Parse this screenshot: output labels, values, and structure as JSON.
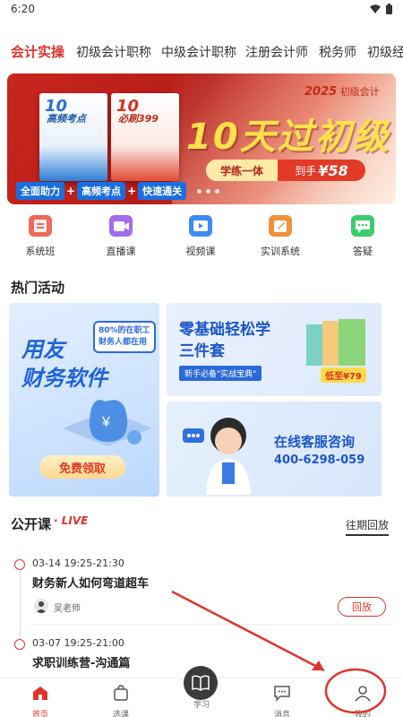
{
  "status": {
    "time": "6:20",
    "wifi_icon": "wifi-icon",
    "battery_icon": "battery-icon"
  },
  "tabs": [
    {
      "label": "会计实操",
      "active": true
    },
    {
      "label": "初级会计职称"
    },
    {
      "label": "中级会计职称"
    },
    {
      "label": "注册会计师"
    },
    {
      "label": "税务师"
    },
    {
      "label": "初级经"
    }
  ],
  "banner": {
    "year_label": "2025",
    "year_suffix": "初级会计",
    "headline": "10天过初级",
    "book1_num": "10",
    "book1_title": "高频考点",
    "book2_num": "10",
    "book2_title": "必刷399",
    "pill_left": "学练一体",
    "pill_prefix": "到手",
    "pill_price": "¥58",
    "tags": [
      "全面助力",
      "高频考点",
      "快速通关"
    ],
    "accent": "#e0342c"
  },
  "nav": [
    {
      "label": "系统班",
      "icon": "class-icon",
      "color": "#ef6a5a"
    },
    {
      "label": "直播课",
      "icon": "live-video-icon",
      "color": "#a36af2"
    },
    {
      "label": "视频课",
      "icon": "video-tv-icon",
      "color": "#3e8cf2"
    },
    {
      "label": "实训系统",
      "icon": "training-edit-icon",
      "color": "#f2903a"
    },
    {
      "label": "答疑",
      "icon": "qa-chat-icon",
      "color": "#3ccd6c"
    }
  ],
  "hot": {
    "title": "热门活动",
    "yongyou_title_1": "用友",
    "yongyou_title_2": "财务软件",
    "yongyou_bubble": "80%的在职工财务人都在用",
    "yongyou_button": "免费领取",
    "zero_title_1": "零基础轻松学",
    "zero_title_2": "三件套",
    "zero_tag": "新手必备\"实战宝典\"",
    "zero_price": "低至¥79",
    "service_title": "在线客服咨询",
    "service_phone": "400-6298-059"
  },
  "open_course": {
    "title": "公开课",
    "live_tag": "· LIVE",
    "replay_link": "往期回放",
    "items": [
      {
        "time": "03-14 19:25-21:30",
        "title": "财务新人如何弯道超车",
        "teacher": "吴老师",
        "button": "回放"
      },
      {
        "time": "03-07 19:25-21:00",
        "title": "求职训练营-沟通篇"
      }
    ]
  },
  "tabbar": [
    {
      "label": "首页",
      "active": true,
      "icon": "home-icon"
    },
    {
      "label": "选课",
      "icon": "bag-icon"
    },
    {
      "label": "学习",
      "icon": "book-icon"
    },
    {
      "label": "消息",
      "icon": "message-icon"
    },
    {
      "label": "我的",
      "icon": "profile-icon"
    }
  ]
}
